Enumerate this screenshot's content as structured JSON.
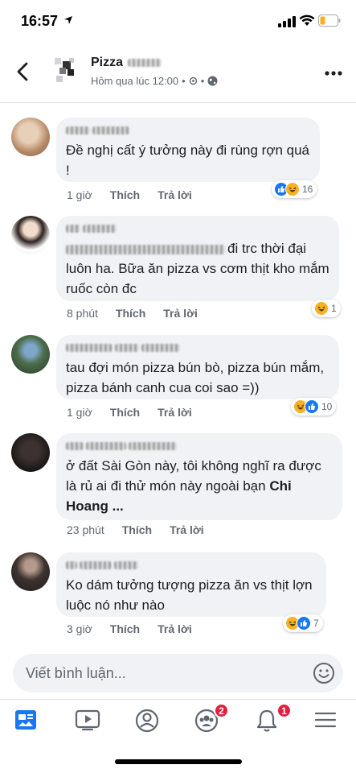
{
  "status_bar": {
    "time": "16:57"
  },
  "header": {
    "page_name": "Pizza",
    "post_time": "Hôm qua lúc 12:00"
  },
  "labels": {
    "like": "Thích",
    "reply": "Trả lời"
  },
  "comments": [
    {
      "text": "Đề nghị cất ý tưởng này đi rùng rợn quá !",
      "time": "1 giờ",
      "reaction_count": "16",
      "reactions": [
        "like",
        "haha"
      ]
    },
    {
      "text": "đi trc thời đại luôn ha. Bữa ăn pizza vs cơm thịt kho mắm ruốc còn đc",
      "time": "8 phút",
      "reaction_count": "1",
      "reactions": [
        "haha"
      ]
    },
    {
      "text": "tau đợi món pizza bún bò, pizza bún mắm, pizza bánh canh cua coi sao =))",
      "time": "1 giờ",
      "reaction_count": "10",
      "reactions": [
        "haha",
        "like"
      ]
    },
    {
      "text": "ở đất Sài Gòn này, tôi không nghĩ ra được là rủ ai đi thử món này ngoài bạn",
      "mention": "Chi Hoang ...",
      "time": "23 phút",
      "reaction_count": "",
      "reactions": []
    },
    {
      "text": "Ko dám tưởng tượng pizza ăn vs thịt lợn luộc nó như nào",
      "time": "3 giờ",
      "reaction_count": "7",
      "reactions": [
        "haha",
        "like"
      ]
    }
  ],
  "composer": {
    "placeholder": "Viết bình luận..."
  },
  "tabbar": {
    "items": [
      "news-feed",
      "watch",
      "profile",
      "groups",
      "notifications",
      "menu"
    ],
    "groups_badge": "2",
    "notifications_badge": "1"
  },
  "colors": {
    "facebook_blue": "#1877f2",
    "badge_red": "#e41e3f",
    "bubble_gray": "#f0f2f5"
  }
}
